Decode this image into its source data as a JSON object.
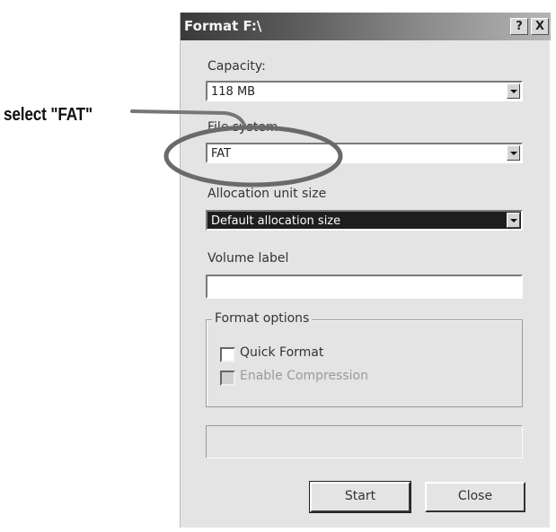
{
  "callout": "select \"FAT\"",
  "dialog": {
    "title": "Format F:\\",
    "help_button": "?",
    "close_button": "X",
    "capacity_label": "Capacity:",
    "capacity_value": "118 MB",
    "filesystem_label": "File system",
    "filesystem_value": "FAT",
    "allocation_label": "Allocation unit size",
    "allocation_value": "Default allocation size",
    "volume_label": "Volume label",
    "volume_value": "",
    "options_title": "Format options",
    "quick_format_label": "Quick Format",
    "compression_label": "Enable Compression",
    "start_button": "Start",
    "close_action_button": "Close"
  }
}
